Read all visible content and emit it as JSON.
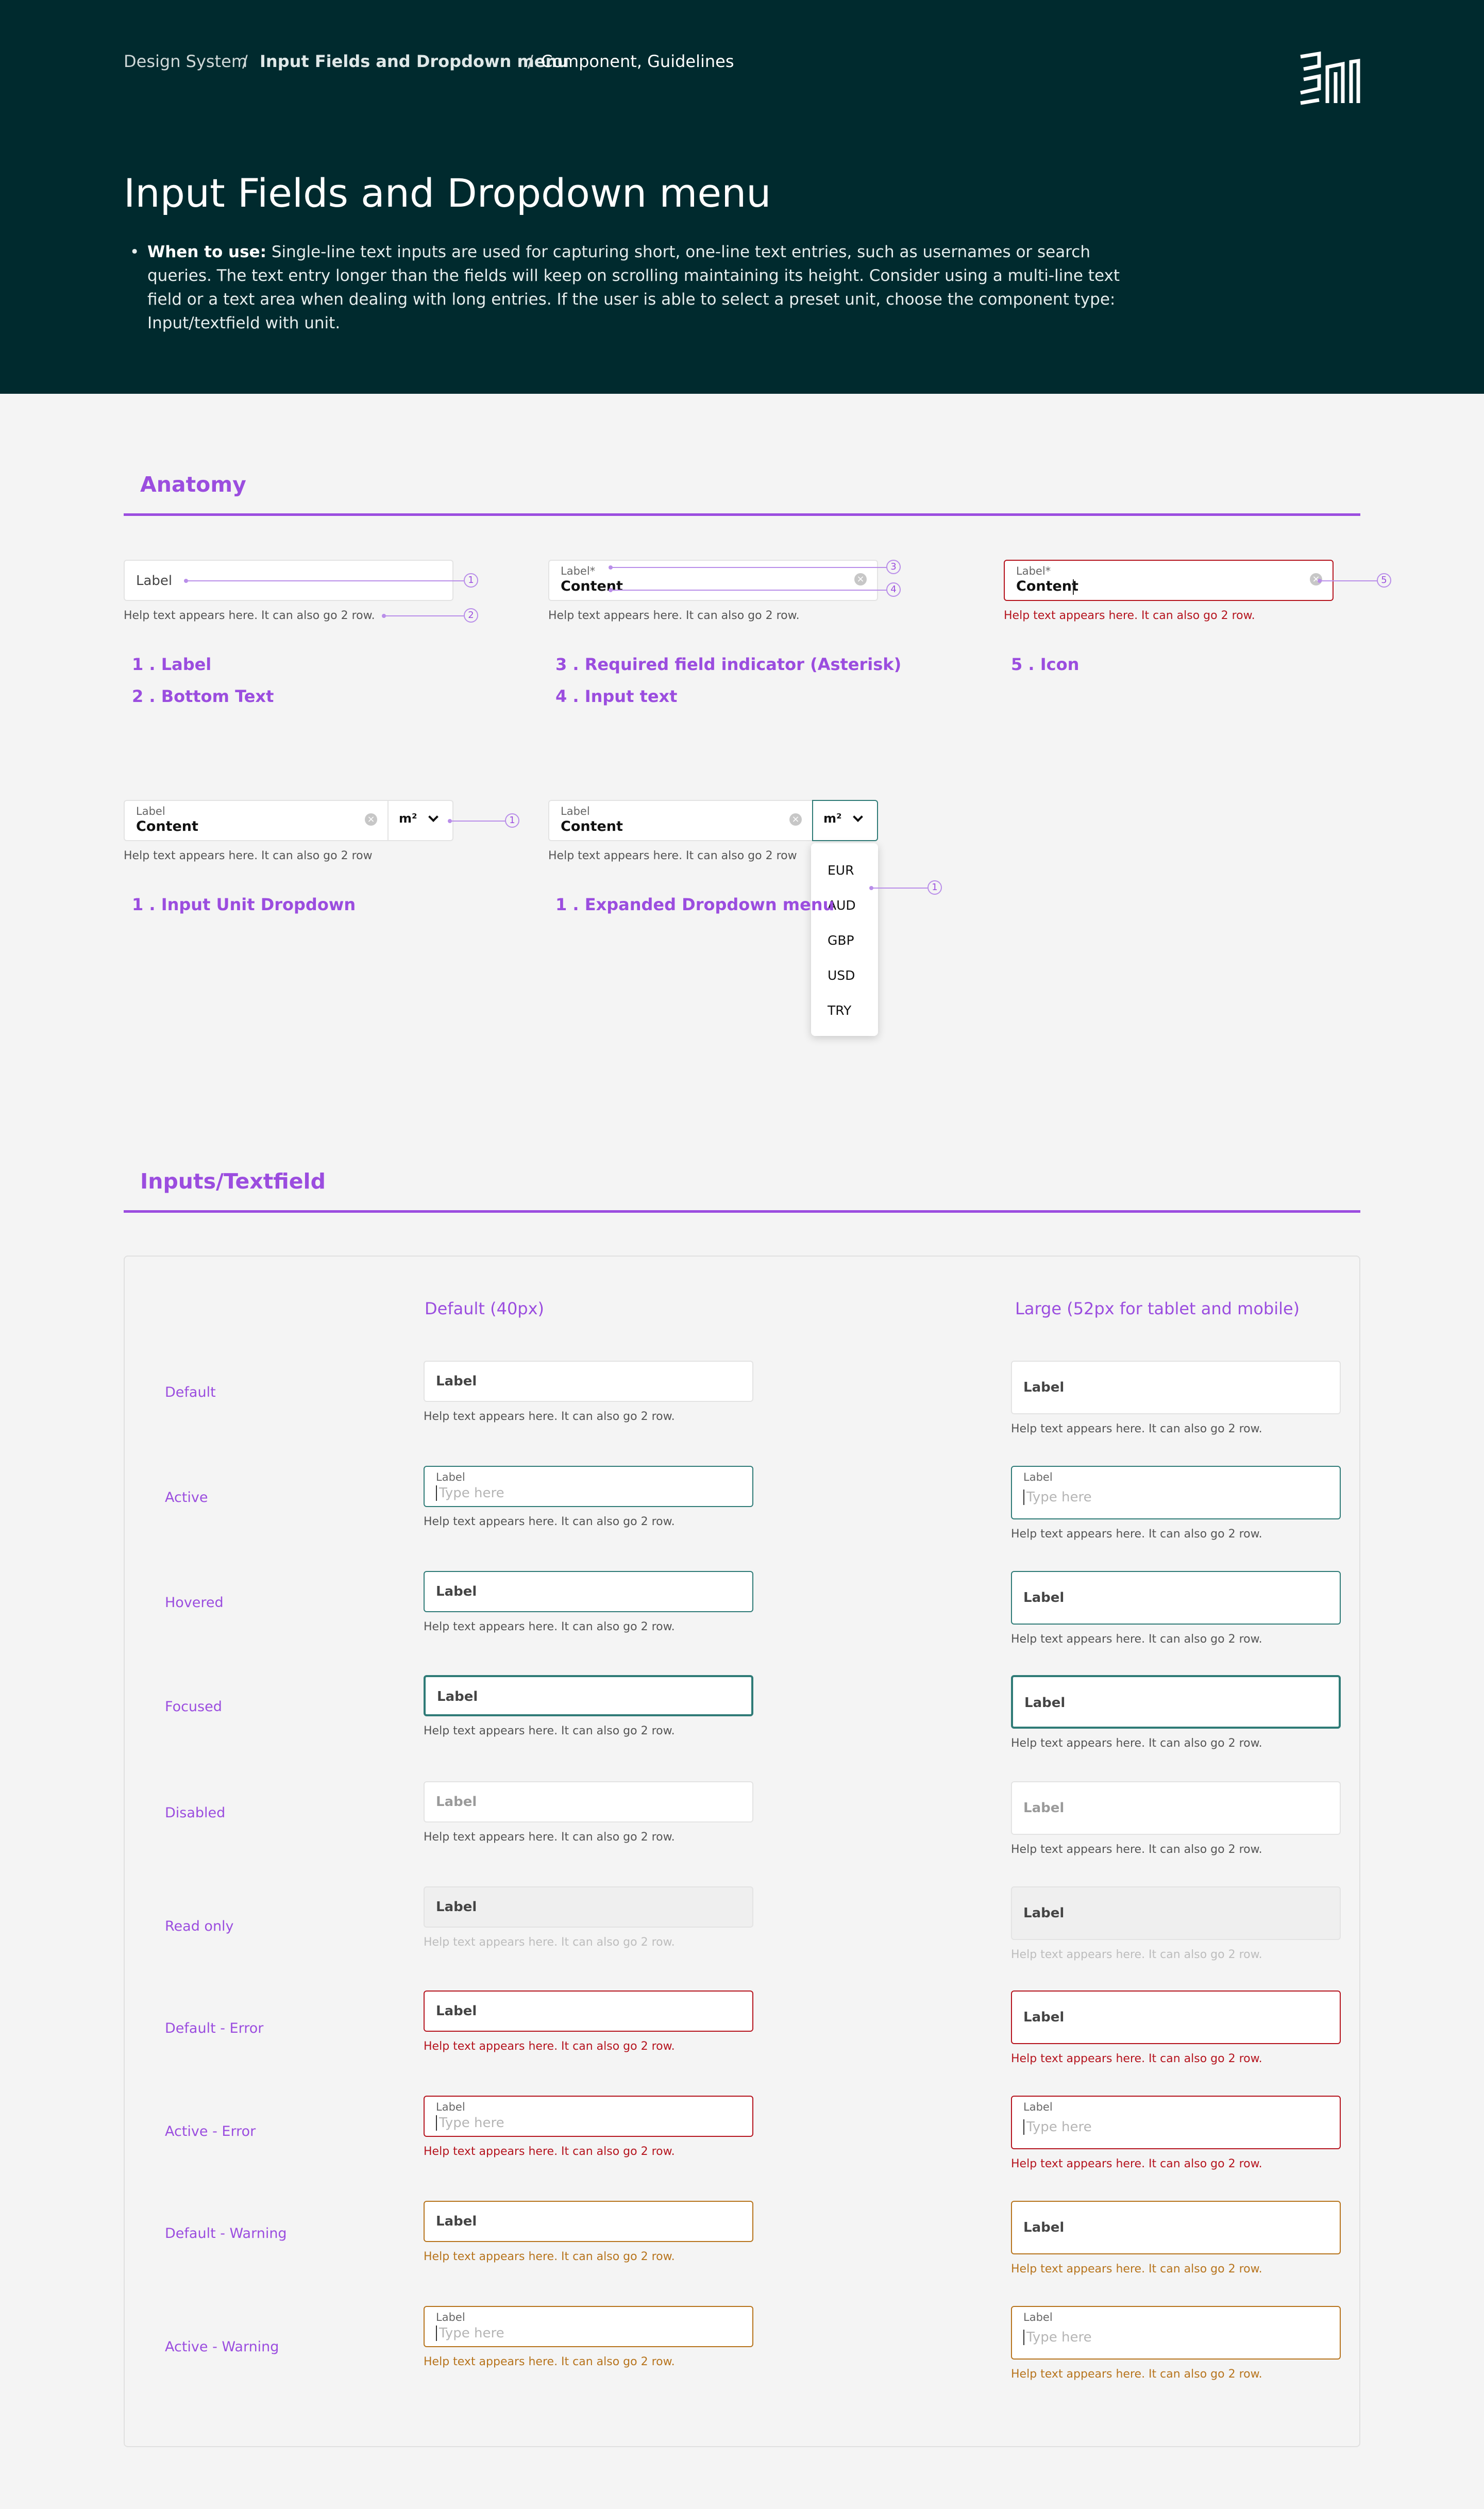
{
  "breadcrumb": {
    "root": "Design System",
    "sep1": "/",
    "current": "Input Fields and Dropdown menu",
    "sep2": "/",
    "tail": "Component, Guidelines"
  },
  "hero": {
    "title": "Input Fields and Dropdown menu",
    "bullet": "•",
    "desc_bold": "When to use:",
    "desc": " Single-line text inputs are used for capturing short, one-line text entries, such as usernames or search queries. The text entry longer than the fields will keep on scrolling maintaining its height. Consider using a multi-line text field or a text area when dealing with long entries. If the user is able to select a preset unit, choose the component type: Input/textfield with unit."
  },
  "anatomy": {
    "title": "Anatomy",
    "label": "Label",
    "label_req": "Label*",
    "content": "Content",
    "help": "Help text appears here. It can also go 2 row.",
    "help_short": "Help text appears here. It can also go 2 row",
    "clear_glyph": "×",
    "unit": "m²",
    "markers": [
      "1",
      "2",
      "3",
      "4",
      "5"
    ],
    "legend": {
      "l1": "1 .  Label",
      "l2": "2 .  Bottom Text",
      "l3": "3 .  Required field indicator (Asterisk)",
      "l4": "4 .  Input text",
      "l5": "5 .  Icon",
      "unit_dd": "1 .  Input Unit Dropdown",
      "expanded": "1 .  Expanded Dropdown menu"
    },
    "dropdown_options": [
      "EUR",
      "AUD",
      "GBP",
      "USD",
      "TRY"
    ]
  },
  "textfield": {
    "title": "Inputs/Textfield",
    "col_default": "Default (40px)",
    "col_large": "Large (52px for tablet and mobile)",
    "label": "Label",
    "placeholder": "Type here",
    "help": "Help text appears here. It can also go 2 row.",
    "rows": [
      "Default",
      "Active",
      "Hovered",
      "Focused",
      "Disabled",
      "Read only",
      "Default - Error",
      "Active - Error",
      "Default - Warning",
      "Active - Warning"
    ]
  },
  "colors": {
    "hero_bg": "#002a2e",
    "accent": "#9b4ddf",
    "teal_border": "#2f7b77",
    "error": "#b5141e",
    "warning": "#b7741d"
  }
}
